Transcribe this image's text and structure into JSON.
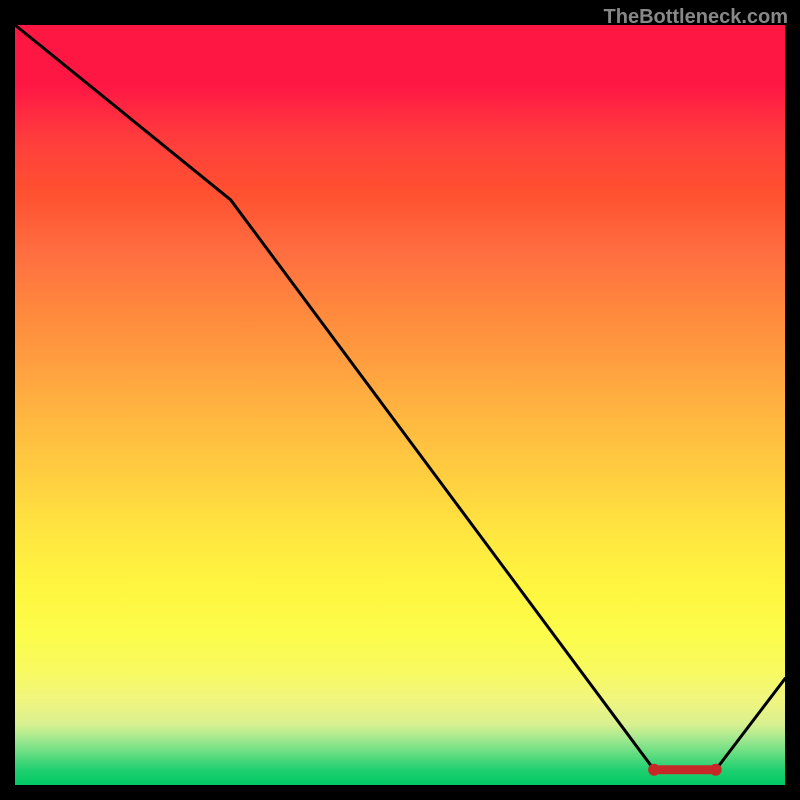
{
  "watermark": "TheBottleneck.com",
  "chart_data": {
    "type": "line",
    "title": "",
    "xlabel": "",
    "ylabel": "",
    "xlim": [
      0,
      100
    ],
    "ylim": [
      0,
      100
    ],
    "x": [
      0,
      28,
      83,
      91,
      100
    ],
    "values": [
      100,
      77,
      2,
      2,
      14
    ],
    "highlight_segment": {
      "x_start": 83,
      "x_end": 91,
      "value": 2
    },
    "gradient_stops": [
      {
        "pos": 0,
        "color": "#ff1744"
      },
      {
        "pos": 100,
        "color": "#00c864"
      }
    ]
  }
}
